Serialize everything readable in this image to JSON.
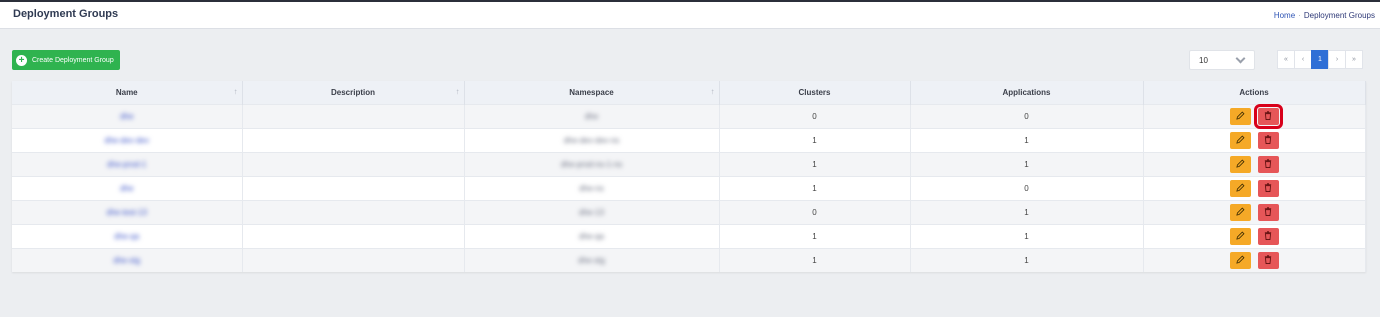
{
  "header": {
    "title": "Deployment Groups",
    "breadcrumb": [
      "Home",
      "Deployment Groups"
    ]
  },
  "toolbar": {
    "create_label": "Create Deployment Group",
    "page_size": "10"
  },
  "pagination": {
    "first": "«",
    "prev": "‹",
    "current": "1",
    "next": "›",
    "last": "»"
  },
  "table": {
    "columns": [
      "Name",
      "Description",
      "Namespace",
      "Clusters",
      "Applications",
      "Actions"
    ],
    "rows": [
      {
        "name": "dhe",
        "description": "",
        "namespace": "dhe",
        "clusters": "0",
        "applications": "0"
      },
      {
        "name": "dhe-dev-dev",
        "description": "",
        "namespace": "dhe-dev-dev-ns",
        "clusters": "1",
        "applications": "1"
      },
      {
        "name": "dhe-prod-1",
        "description": "",
        "namespace": "dhe-prod-ns-1-ns",
        "clusters": "1",
        "applications": "1"
      },
      {
        "name": "dhe",
        "description": "",
        "namespace": "dhe-ns",
        "clusters": "1",
        "applications": "0"
      },
      {
        "name": "dhe-test-13",
        "description": "",
        "namespace": "dhe-13",
        "clusters": "0",
        "applications": "1"
      },
      {
        "name": "dhe-qa",
        "description": "",
        "namespace": "dhe-qa",
        "clusters": "1",
        "applications": "1"
      },
      {
        "name": "dhe-stg",
        "description": "",
        "namespace": "dhe-stg",
        "clusters": "1",
        "applications": "1"
      }
    ]
  },
  "colors": {
    "accent": "#2f6fd6",
    "create_button": "#2fb34f",
    "edit_button": "#f5a927",
    "delete_button": "#e65658",
    "highlight": "#d8001a"
  },
  "icons": {
    "create": "plus-circle-icon",
    "edit": "pencil-icon",
    "delete": "trash-icon",
    "sort": "sort-arrow-icon",
    "page_size": "chevron-down-icon"
  }
}
